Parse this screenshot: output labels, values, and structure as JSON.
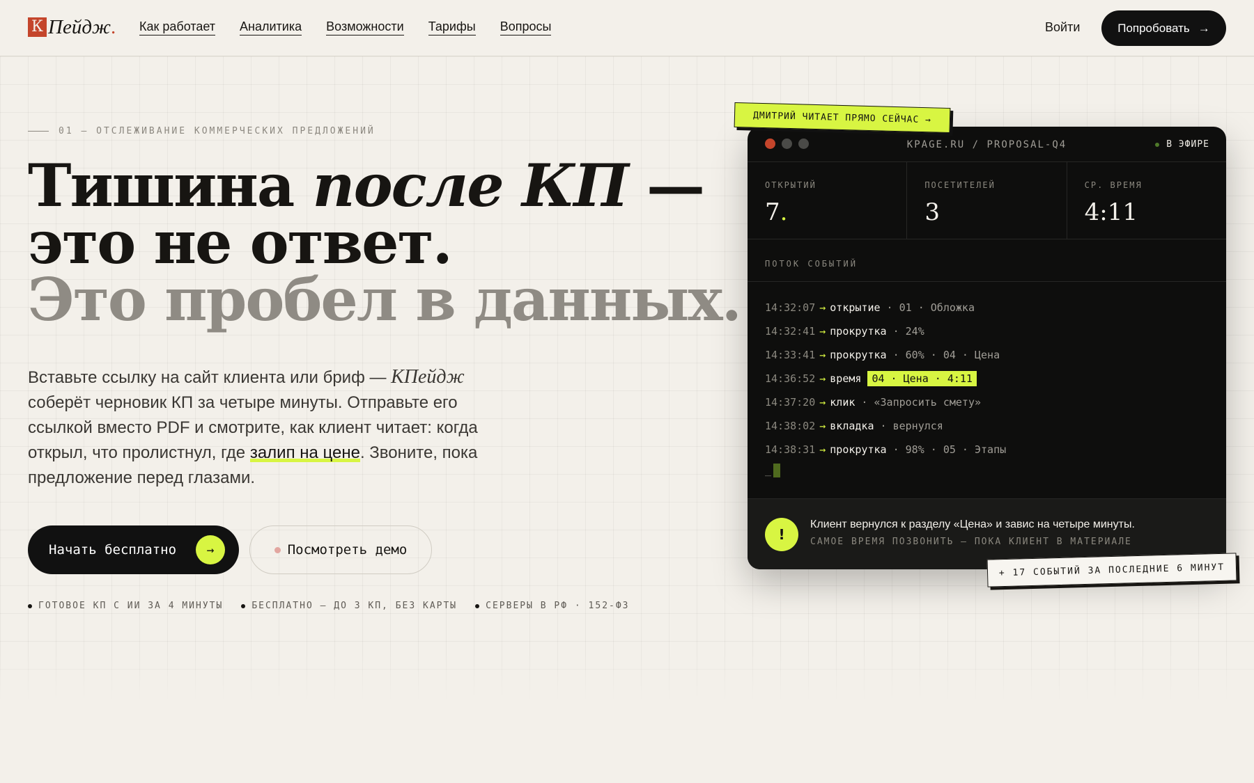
{
  "header": {
    "logo": {
      "mark": "К",
      "name": "Пейдж",
      "dot": "."
    },
    "nav": [
      "Как работает",
      "Аналитика",
      "Возможности",
      "Тарифы",
      "Вопросы"
    ],
    "login": "Войти",
    "cta": "Попробовать",
    "cta_arrow": "→"
  },
  "hero": {
    "eyebrow": "01 — ОТСЛЕЖИВАНИЕ КОММЕРЧЕСКИХ ПРЕДЛОЖЕНИЙ",
    "headline": {
      "line1_a": "Тишина ",
      "line1_b": "после КП",
      "line1_c": " —",
      "line2": "это не ответ.",
      "line3": "Это пробел в данных."
    },
    "lead": {
      "p1": "Вставьте ссылку на сайт клиента или бриф — ",
      "brand": "КПейдж",
      "p2": " соберёт черновик КП за четыре минуты. Отправьте его ссылкой вместо PDF и смотрите, как клиент читает: когда открыл, что пролистнул, где ",
      "highlight": "залип на цене",
      "p3": ". Звоните, пока предложение перед глазами."
    },
    "primary_cta": "Начать бесплатно",
    "primary_arrow": "→",
    "secondary_cta": "Посмотреть демо",
    "bullets": [
      "ГОТОВОЕ КП С ИИ ЗА 4 МИНУТЫ",
      "БЕСПЛАТНО — ДО 3 КП, БЕЗ КАРТЫ",
      "СЕРВЕРЫ В РФ · 152-ФЗ"
    ]
  },
  "terminal": {
    "sticker_top": "ДМИТРИЙ ЧИТАЕТ ПРЯМО СЕЙЧАС →",
    "title": "KPAGE.RU / PROPOSAL-Q4",
    "live": "В ЭФИРЕ",
    "window_dots": [
      "#c4452b",
      "#4a4a47",
      "#4a4a47"
    ],
    "stats": [
      {
        "label": "ОТКРЫТИЙ",
        "value": "7",
        "suffix": "."
      },
      {
        "label": "ПОСЕТИТЕЛЕЙ",
        "value": "3",
        "suffix": ""
      },
      {
        "label": "СР. ВРЕМЯ",
        "value": "4:11",
        "suffix": ""
      }
    ],
    "feed_label": "ПОТОК СОБЫТИЙ",
    "events": [
      {
        "time": "14:32:07",
        "event": "открытие",
        "rest": " · 01 · Обложка",
        "hl": ""
      },
      {
        "time": "14:32:41",
        "event": "прокрутка",
        "rest": " · 24%",
        "hl": ""
      },
      {
        "time": "14:33:41",
        "event": "прокрутка",
        "rest": " · 60% · 04 · Цена",
        "hl": ""
      },
      {
        "time": "14:36:52",
        "event": "время",
        "rest": " ",
        "hl": "04 · Цена · 4:11"
      },
      {
        "time": "14:37:20",
        "event": "клик",
        "rest": " · «Запросить смету»",
        "hl": ""
      },
      {
        "time": "14:38:02",
        "event": "вкладка",
        "rest": " · вернулся",
        "hl": ""
      },
      {
        "time": "14:38:31",
        "event": "прокрутка",
        "rest": " · 98% · 05 · Этапы",
        "hl": ""
      }
    ],
    "event_arrow": "→",
    "cursor": "_",
    "alert": {
      "icon": "!",
      "main": "Клиент вернулся к разделу «Цена» и завис на четыре минуты.",
      "sub": "САМОЕ ВРЕМЯ ПОЗВОНИТЬ — ПОКА КЛИЕНТ В МАТЕРИАЛЕ"
    },
    "sticker_bottom": "+ 17 СОБЫТИЙ ЗА ПОСЛЕДНИЕ 6 МИНУТ"
  },
  "colors": {
    "background": "#f3f0ea",
    "accent": "#d8f542",
    "brand": "#c4452b",
    "dark": "#0e0e0d"
  }
}
